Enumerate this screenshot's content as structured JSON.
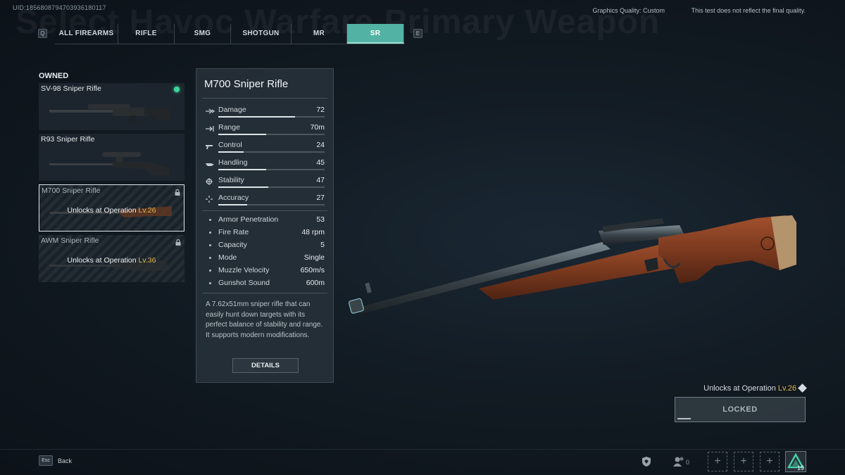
{
  "header": {
    "uid": "UID:1856808794703936180117",
    "background_title": "Select Havoc Warfare Primary Weapon",
    "graphics_quality": "Graphics Quality: Custom",
    "disclaimer": "This test does not reflect the final quality.",
    "prev_key": "Q",
    "next_key": "E"
  },
  "tabs": [
    {
      "label": "ALL FIREARMS",
      "active": false
    },
    {
      "label": "RIFLE",
      "active": false
    },
    {
      "label": "SMG",
      "active": false
    },
    {
      "label": "SHOTGUN",
      "active": false
    },
    {
      "label": "MR",
      "active": false
    },
    {
      "label": "SR",
      "active": true
    }
  ],
  "weapon_list": {
    "section_label": "OWNED",
    "items": [
      {
        "name": "SV-98 Sniper Rifle",
        "status": "equipped"
      },
      {
        "name": "R93 Sniper Rifle",
        "status": "owned"
      },
      {
        "name": "M700 Sniper Rifle",
        "status": "locked",
        "unlock_prefix": "Unlocks at Operation ",
        "unlock_level": "Lv.26",
        "selected": true
      },
      {
        "name": "AWM Sniper Rifle",
        "status": "locked",
        "unlock_prefix": "Unlocks at Operation ",
        "unlock_level": "Lv.36"
      }
    ]
  },
  "detail": {
    "title": "M700 Sniper Rifle",
    "stats": [
      {
        "label": "Damage",
        "value": "72",
        "fill": 0.72,
        "icon": "damage-icon"
      },
      {
        "label": "Range",
        "value": "70m",
        "fill": 0.45,
        "icon": "range-icon"
      },
      {
        "label": "Control",
        "value": "24",
        "fill": 0.24,
        "icon": "control-icon"
      },
      {
        "label": "Handling",
        "value": "45",
        "fill": 0.45,
        "icon": "handling-icon"
      },
      {
        "label": "Stability",
        "value": "47",
        "fill": 0.47,
        "icon": "stability-icon"
      },
      {
        "label": "Accuracy",
        "value": "27",
        "fill": 0.27,
        "icon": "accuracy-icon"
      }
    ],
    "attributes": [
      {
        "label": "Armor Penetration",
        "value": "53"
      },
      {
        "label": "Fire Rate",
        "value": "48 rpm"
      },
      {
        "label": "Capacity",
        "value": "5"
      },
      {
        "label": "Mode",
        "value": "Single"
      },
      {
        "label": "Muzzle Velocity",
        "value": "650m/s"
      },
      {
        "label": "Gunshot Sound",
        "value": "600m"
      }
    ],
    "description": "A 7.62x51mm sniper rifle that can easily hunt down targets with its perfect balance of stability and range. It supports modern modifications.",
    "details_button": "DETAILS"
  },
  "preview": {
    "unlock_prefix": "Unlocks at Operation ",
    "unlock_level": "Lv.26",
    "locked_button": "LOCKED",
    "progress_fraction": 0.1
  },
  "footer": {
    "esc_key": "Esc",
    "back_label": "Back",
    "party_count": "0",
    "player_level": "19"
  },
  "colors": {
    "accent": "#52b3a4",
    "equipped": "#3fd39c",
    "level": "#e0b54a"
  }
}
